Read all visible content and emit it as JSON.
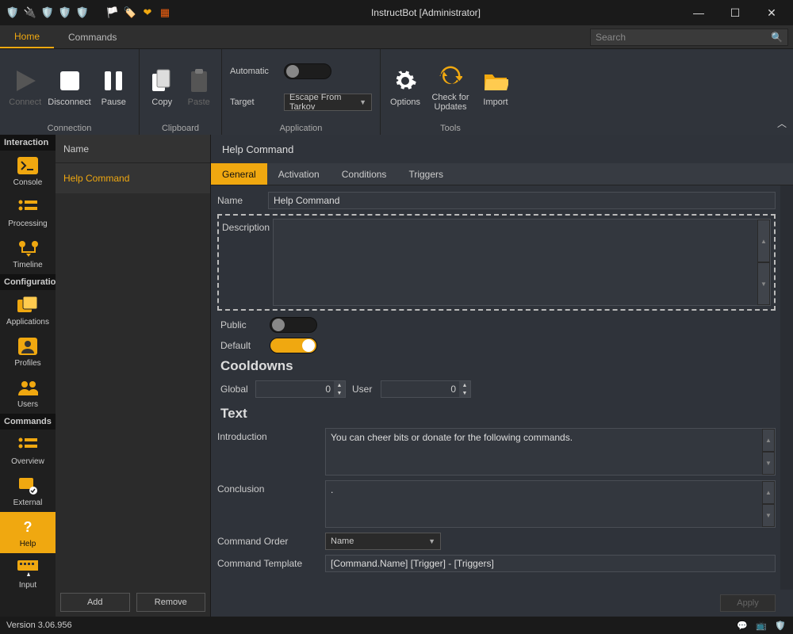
{
  "window": {
    "title": "InstructBot [Administrator]"
  },
  "menu": {
    "tabs": [
      "Home",
      "Commands"
    ],
    "active": 0,
    "search_placeholder": "Search"
  },
  "ribbon": {
    "connection": {
      "label": "Connection",
      "connect": "Connect",
      "disconnect": "Disconnect",
      "pause": "Pause"
    },
    "clipboard": {
      "label": "Clipboard",
      "copy": "Copy",
      "paste": "Paste"
    },
    "application": {
      "label": "Application",
      "automatic": "Automatic",
      "automatic_on": false,
      "target": "Target",
      "target_value": "Escape From Tarkov"
    },
    "tools": {
      "label": "Tools",
      "options": "Options",
      "updates": "Check for Updates",
      "import": "Import"
    }
  },
  "sidebar": {
    "interaction": {
      "label": "Interaction",
      "items": [
        {
          "id": "console",
          "label": "Console"
        },
        {
          "id": "processing",
          "label": "Processing"
        },
        {
          "id": "timeline",
          "label": "Timeline"
        }
      ]
    },
    "configuration": {
      "label": "Configuration",
      "items": [
        {
          "id": "applications",
          "label": "Applications"
        },
        {
          "id": "profiles",
          "label": "Profiles"
        },
        {
          "id": "users",
          "label": "Users"
        }
      ]
    },
    "commands": {
      "label": "Commands",
      "items": [
        {
          "id": "overview",
          "label": "Overview"
        },
        {
          "id": "external",
          "label": "External"
        },
        {
          "id": "help",
          "label": "Help",
          "active": true
        },
        {
          "id": "input",
          "label": "Input"
        }
      ]
    }
  },
  "list": {
    "header": "Name",
    "rows": [
      "Help Command"
    ],
    "add": "Add",
    "remove": "Remove"
  },
  "editor": {
    "title": "Help Command",
    "tabs": [
      "General",
      "Activation",
      "Conditions",
      "Triggers"
    ],
    "active_tab": 0,
    "name_label": "Name",
    "name_value": "Help Command",
    "description_label": "Description",
    "description_value": "",
    "public_label": "Public",
    "public_on": false,
    "default_label": "Default",
    "default_on": true,
    "cooldowns": {
      "title": "Cooldowns",
      "global_label": "Global",
      "global_value": "0",
      "user_label": "User",
      "user_value": "0"
    },
    "text": {
      "title": "Text",
      "intro_label": "Introduction",
      "intro_value": "You can cheer bits or donate for the following commands.",
      "conclusion_label": "Conclusion",
      "conclusion_value": ".",
      "order_label": "Command Order",
      "order_value": "Name",
      "template_label": "Command Template",
      "template_value": "[Command.Name] [Trigger] - [Triggers]"
    },
    "apply": "Apply"
  },
  "status": {
    "version": "Version 3.06.956"
  }
}
